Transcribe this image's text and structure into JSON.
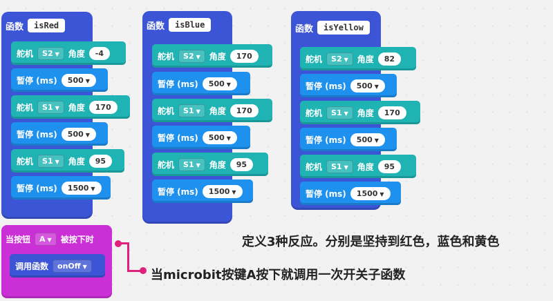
{
  "blocks": {
    "function_label": "函数",
    "servo_label": "舵机",
    "angle_label": "角度",
    "pause_label": "暂停 (ms)"
  },
  "functions": [
    {
      "name": "isRed",
      "steps": [
        {
          "servo": "S2",
          "angle": "-4"
        },
        {
          "pause": "500"
        },
        {
          "servo": "S1",
          "angle": "170"
        },
        {
          "pause": "500"
        },
        {
          "servo": "S1",
          "angle": "95"
        },
        {
          "pause": "1500"
        }
      ]
    },
    {
      "name": "isBlue",
      "steps": [
        {
          "servo": "S2",
          "angle": "170"
        },
        {
          "pause": "500"
        },
        {
          "servo": "S1",
          "angle": "170"
        },
        {
          "pause": "500"
        },
        {
          "servo": "S1",
          "angle": "95"
        },
        {
          "pause": "1500"
        }
      ]
    },
    {
      "name": "isYellow",
      "steps": [
        {
          "servo": "S2",
          "angle": "82"
        },
        {
          "pause": "500"
        },
        {
          "servo": "S1",
          "angle": "170"
        },
        {
          "pause": "500"
        },
        {
          "servo": "S1",
          "angle": "95"
        },
        {
          "pause": "1500"
        }
      ]
    }
  ],
  "event": {
    "label_pre": "当按钮",
    "button": "A",
    "label_post": "被按下时",
    "call_label": "调用函数",
    "call_target": "onOff"
  },
  "notes": {
    "definition": "定义3种反应。分别是坚持到红色，蓝色和黄色",
    "trigger": "当microbit按键A按下就调用一次开关子函数"
  },
  "colors": {
    "function": "#3c55d6",
    "servo": "#1fb3b3",
    "pause": "#1e90ee",
    "event": "#cb2fd6",
    "connector": "#e0207d"
  }
}
